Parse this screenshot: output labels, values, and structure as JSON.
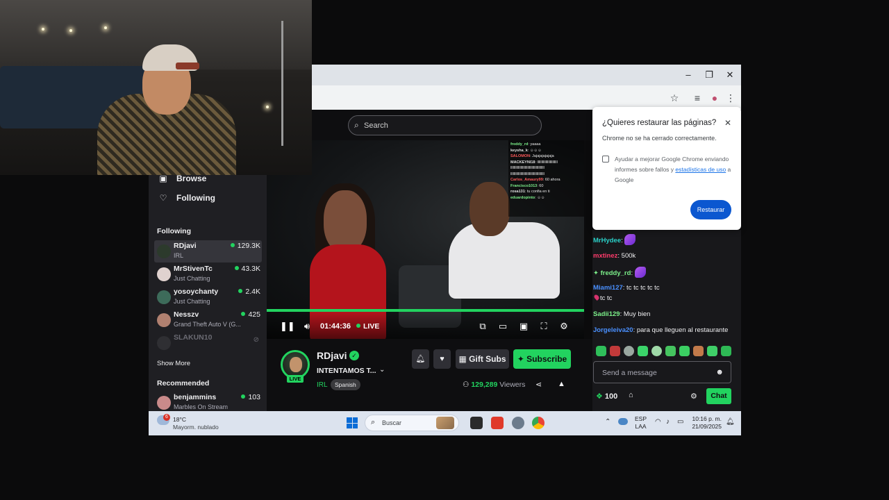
{
  "browser": {
    "minimize": "–",
    "maximize": "❐",
    "close": "✕"
  },
  "search": {
    "placeholder": "Search"
  },
  "sidebar": {
    "browse": "Browse",
    "following_nav": "Following",
    "following_title": "Following",
    "channels": [
      {
        "name": "RDjavi",
        "category": "IRL",
        "viewers": "129.3K"
      },
      {
        "name": "MrStivenTc",
        "category": "Just Chatting",
        "viewers": "43.3K"
      },
      {
        "name": "yosoychanty",
        "category": "Just Chatting",
        "viewers": "2.4K"
      },
      {
        "name": "Nesszv",
        "category": "Grand Theft Auto V (G...",
        "viewers": "425"
      },
      {
        "name": "SLAKUN10",
        "category": "",
        "viewers": ""
      }
    ],
    "show_more": "Show More",
    "recommended_title": "Recommended",
    "recommended": [
      {
        "name": "benjammins",
        "category": "Marbles On Stream",
        "viewers": "103"
      }
    ]
  },
  "video": {
    "time": "01:44:36",
    "live": "LIVE",
    "overlay_chat": [
      {
        "user": "freddy_rd",
        "text": ": yaaaa",
        "color": "#7cf08a"
      },
      {
        "user": "keysha_k",
        "text": ": ☺☺☺",
        "color": "#e0e0e0"
      },
      {
        "user": "SALOMON",
        "text": ": Jajajajajajaja",
        "color": "#ff5a5a"
      },
      {
        "user": "MACKEYNI18",
        "text": ": llllllllllllllllllllllll",
        "color": "#e0e0e0"
      },
      {
        "user": "",
        "text": "llllllllllllllllllllllllllllllllllllllll",
        "color": "#e0e0e0"
      },
      {
        "user": "",
        "text": "llllllllllllllllllllllllllllllllllllllll",
        "color": "#e0e0e0"
      },
      {
        "user": "Carlos_Amaury99",
        "text": ": 60 ahora",
        "color": "#ff5a5a"
      },
      {
        "user": "Francisco1013",
        "text": ": 60",
        "color": "#7cf08a"
      },
      {
        "user": "rosa131",
        "text": ": tu confia en ti",
        "color": "#e0e0e0"
      },
      {
        "user": "eduardopinto",
        "text": ": ☺☺",
        "color": "#7cf08a"
      }
    ]
  },
  "channel": {
    "live_badge": "LIVE",
    "name": "RDjavi",
    "title": "INTENTAMOS T...",
    "category": "IRL",
    "tag": "Spanish",
    "gift": "Gift Subs",
    "subscribe": "Subscribe",
    "viewers_count": "129,289",
    "viewers_label": "Viewers"
  },
  "restore": {
    "title": "¿Quieres restaurar las páginas?",
    "message": "Chrome no se ha cerrado correctamente.",
    "checkbox_text_1": "Ayudar a mejorar Google Chrome enviando informes sobre fallos y ",
    "checkbox_link": "estadísticas de uso",
    "checkbox_text_2": " a Google",
    "button": "Restaurar"
  },
  "chat": {
    "messages": [
      {
        "user": "MrHydee",
        "sep": ":",
        "text": "",
        "color": "#2ad0c8"
      },
      {
        "user": "mxtinez",
        "sep": ":",
        "text": " 500k",
        "color": "#ff3b6b"
      },
      {
        "user": "freddy_rd",
        "sep": ":",
        "text": "",
        "color": "#7cf08a"
      },
      {
        "user": "Miami127",
        "sep": ":",
        "text": " tc tc tc tc tc",
        "color": "#4a90ff"
      },
      {
        "user": "",
        "sep": "",
        "text": "tc tc",
        "color": "#efeff1"
      },
      {
        "user": "Sadii129",
        "sep": ":",
        "text": " Muy bien",
        "color": "#7cf08a"
      },
      {
        "user": "Jorgeleiva20",
        "sep": ":",
        "text": " para que lleguen al restaurante",
        "color": "#4a90ff"
      }
    ],
    "input_placeholder": "Send a message",
    "points": "100",
    "chat_button": "Chat"
  },
  "taskbar": {
    "weather_badge": "6",
    "temp": "18°C",
    "weather_desc": "Mayorm. nublado",
    "search": "Buscar",
    "lang_1": "ESP",
    "lang_2": "LAA",
    "time": "10:16 p. m.",
    "date": "21/09/2025"
  }
}
